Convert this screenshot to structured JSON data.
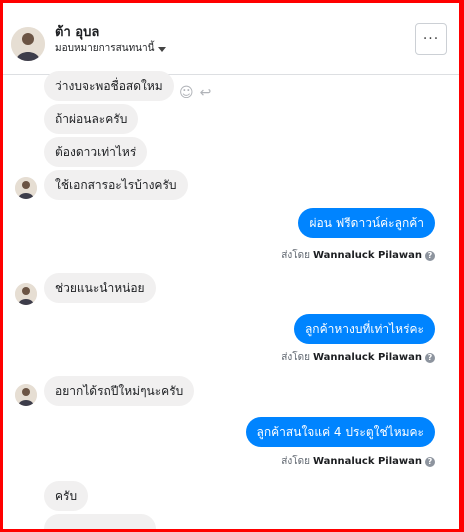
{
  "header": {
    "name": "ต้า อุบล",
    "assign_label": "มอบหมายการสนทนานี้",
    "more_label": "···"
  },
  "messages": [
    {
      "dir": "in",
      "text": "ว่างบจะพอชื่อสดใหม"
    },
    {
      "dir": "in",
      "text": "ถ้าผ่อนละครับ"
    },
    {
      "dir": "in",
      "text": "ต้องดาวเท่าไหร่"
    },
    {
      "dir": "in",
      "text": "ใช้เอกสารอะไรบ้างครับ"
    },
    {
      "dir": "out",
      "text": "ผ่อน ฟรีดาวน์ค่ะลูกค้า"
    },
    {
      "dir": "in",
      "text": "ช่วยแนะนำหน่อย"
    },
    {
      "dir": "out",
      "text": "ลูกค้าหางบที่เท่าไหร่คะ"
    },
    {
      "dir": "in",
      "text": "อยากได้รถปีใหม่ๆนะครับ"
    },
    {
      "dir": "out",
      "text": "ลูกค้าสนใจแค่ 4 ประตูใช่ไหมคะ"
    },
    {
      "dir": "in",
      "text": "ครับ"
    }
  ],
  "sent_by": {
    "prefix": "ส่งโดย",
    "agent": "Wannaluck Pilawan",
    "help": "?"
  },
  "icons": {
    "react": "smiley-icon",
    "reply": "reply-icon"
  },
  "colors": {
    "outgoing": "#0084ff",
    "incoming": "#f1f0f0",
    "border": "#ff0000"
  }
}
